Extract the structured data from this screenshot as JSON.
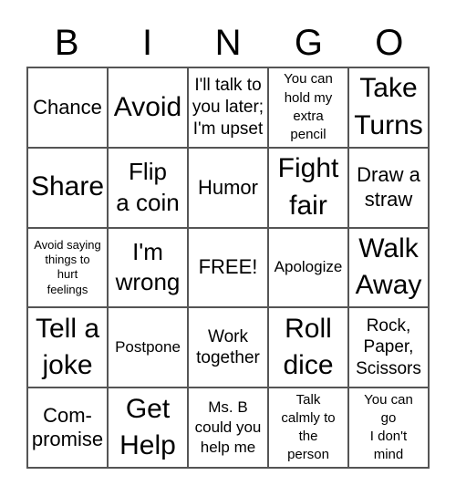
{
  "header": {
    "letters": [
      "B",
      "I",
      "N",
      "G",
      "O"
    ]
  },
  "grid": {
    "cells": [
      "Chance",
      "Avoid",
      "I'll talk to\nyou later;\nI'm upset",
      "You can\nhold my\nextra\npencil",
      "Take\nTurns",
      "Share",
      "Flip\na coin",
      "Humor",
      "Fight\nfair",
      "Draw a\nstraw",
      "Avoid saying\nthings to\nhurt\nfeelings",
      "I'm\nwrong",
      "FREE!",
      "Apologize",
      "Walk\nAway",
      "Tell a\njoke",
      "Postpone",
      "Work\ntogether",
      "Roll\ndice",
      "Rock,\nPaper,\nScissors",
      "Com-\npromise",
      "Get\nHelp",
      "Ms. B\ncould you\nhelp me",
      "Talk\ncalmly to\nthe\nperson",
      "You can\ngo\nI don't\nmind"
    ]
  }
}
